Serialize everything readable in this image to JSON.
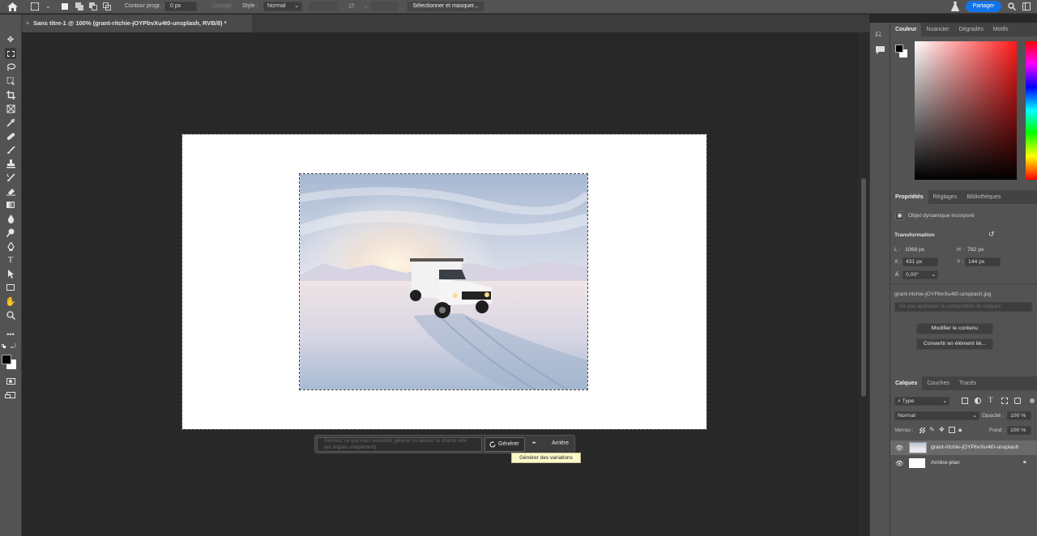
{
  "topbar": {
    "contour_label": "Contour progr. :",
    "contour_value": "0 px",
    "lissage_label": "Lissage",
    "style_label": "Style :",
    "style_value": "Normal",
    "select_mask_button": "Sélectionner et masquer...",
    "share_button": "Partager"
  },
  "document_tab": {
    "close": "×",
    "title": "Sans titre-1 @ 100% (grant-ritchie-jOYPbvXu4t0-unsplash, RVB/8) *"
  },
  "contextual_bar": {
    "prompt_placeholder": "Décrivez ce que vous souhaitez générer ou laissez ce champ vide (en anglais uniquement)",
    "generate_button": "Générer",
    "more_label": "•••",
    "back_button": "Arrière",
    "tooltip": "Générer des variations"
  },
  "color_panel": {
    "tabs": [
      "Couleur",
      "Nuancier",
      "Dégradés",
      "Motifs"
    ],
    "active_tab": "Couleur",
    "foreground": "#000000",
    "background": "#ffffff",
    "hue_color": "#ff1a1a"
  },
  "properties_panel": {
    "tabs": [
      "Propriétés",
      "Réglages",
      "Bibliothèques"
    ],
    "active_tab": "Propriétés",
    "object_type": "Objet dynamique incorporé",
    "transform_heading": "Transformation",
    "width_label": "L :",
    "width_value": "1068 px",
    "height_label": "H :",
    "height_value": "792 px",
    "x_label": "X :",
    "x_value": "431 px",
    "y_label": "Y :",
    "y_value": "144 px",
    "angle_value": "0,00°",
    "file_name": "grant-ritchie-jOYPbvXu4t0-unsplash.jpg",
    "comp_placeholder": "Ne pas appliquer la composition de calques",
    "edit_content_button": "Modifier le contenu",
    "convert_button": "Convertir en élément lié..."
  },
  "layers_panel": {
    "tabs": [
      "Calques",
      "Couches",
      "Tracés"
    ],
    "active_tab": "Calques",
    "filter_kind": "Type",
    "blend_mode": "Normal",
    "opacity_label": "Opacité :",
    "opacity_value": "100 %",
    "lock_label": "Verrou :",
    "fill_label": "Fond :",
    "fill_value": "100 %",
    "layers": [
      {
        "name": "grant-ritchie-jOYPbvXu4t0-unsplash",
        "selected": true
      },
      {
        "name": "Arrière-plan",
        "selected": false
      }
    ]
  },
  "colors": {
    "share_blue": "#1473e6",
    "tooltip_bg": "#fcf8c9",
    "ui_gray": "#535353",
    "canvas_bg": "#282828"
  }
}
